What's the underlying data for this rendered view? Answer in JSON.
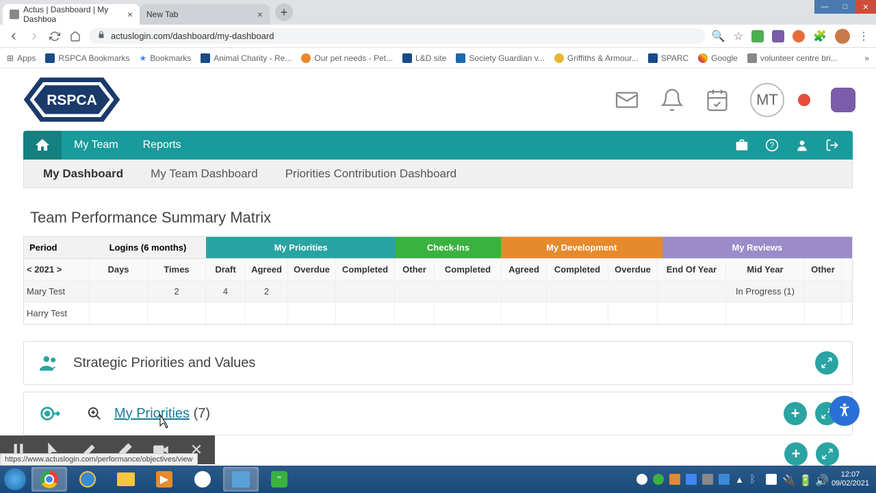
{
  "browser": {
    "tabs": [
      {
        "title": "Actus | Dashboard | My Dashboa"
      },
      {
        "title": "New Tab"
      }
    ],
    "url": "actuslogin.com/dashboard/my-dashboard",
    "bookmarks": [
      "Apps",
      "RSPCA Bookmarks",
      "Bookmarks",
      "Animal Charity - Re...",
      "Our pet needs - Pet...",
      "L&D site",
      "Society Guardian v...",
      "Griffiths & Armour...",
      "SPARC",
      "Google",
      "volunteer centre bri..."
    ],
    "status_url": "https://www.actuslogin.com/performance/objectives/view"
  },
  "header": {
    "logo_text": "RSPCA",
    "avatar_initials": "MT"
  },
  "nav": {
    "main": [
      "My Team",
      "Reports"
    ],
    "sub": [
      "My Dashboard",
      "My Team Dashboard",
      "Priorities Contribution Dashboard"
    ]
  },
  "matrix": {
    "title": "Team Performance Summary Matrix",
    "groups": {
      "period": "Period",
      "logins": "Logins (6 months)",
      "priorities": "My Priorities",
      "checkins": "Check-Ins",
      "development": "My Development",
      "reviews": "My Reviews"
    },
    "cols": {
      "period": "< 2021 >",
      "days": "Days",
      "times": "Times",
      "draft": "Draft",
      "agreed": "Agreed",
      "overdue": "Overdue",
      "completed": "Completed",
      "other": "Other",
      "completed2": "Completed",
      "agreed2": "Agreed",
      "completed3": "Completed",
      "overdue2": "Overdue",
      "eoy": "End Of Year",
      "mid": "Mid Year",
      "other2": "Other"
    },
    "rows": [
      {
        "name": "Mary Test",
        "times": "2",
        "draft": "4",
        "agreed": "2",
        "mid": "In Progress (1)"
      },
      {
        "name": "Harry Test"
      }
    ]
  },
  "panels": {
    "strategic": {
      "title": "Strategic Priorities and Values"
    },
    "priorities": {
      "link": "My Priorities",
      "count": "(7)"
    }
  },
  "taskbar": {
    "time": "12:07",
    "date": "09/02/2021"
  }
}
